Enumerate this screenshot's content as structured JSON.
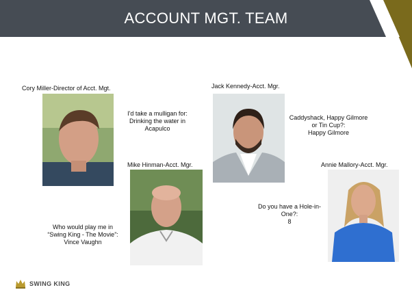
{
  "slide": {
    "title": "ACCOUNT MGT. TEAM",
    "brand": "SWING KING"
  },
  "people": [
    {
      "name_title": "Cory Miller-Director of Acct. Mgt.",
      "answer_lines": [
        "I'd take a mulligan for:",
        "Drinking the water in",
        "Acapulco"
      ]
    },
    {
      "name_title": "Jack Kennedy-Acct. Mgr.",
      "answer_lines": [
        "Caddyshack, Happy Gilmore",
        "or Tin Cup?:",
        "Happy Gilmore"
      ]
    },
    {
      "name_title": "Mike Hinman-Acct. Mgr.",
      "answer_lines": [
        "Who would play me in",
        "“Swing King - The Movie”:",
        "Vince Vaughn"
      ]
    },
    {
      "name_title": "Annie Mallory-Acct. Mgr.",
      "answer_lines": [
        "Do you have a Hole-in-",
        "One?:",
        "8"
      ]
    }
  ]
}
